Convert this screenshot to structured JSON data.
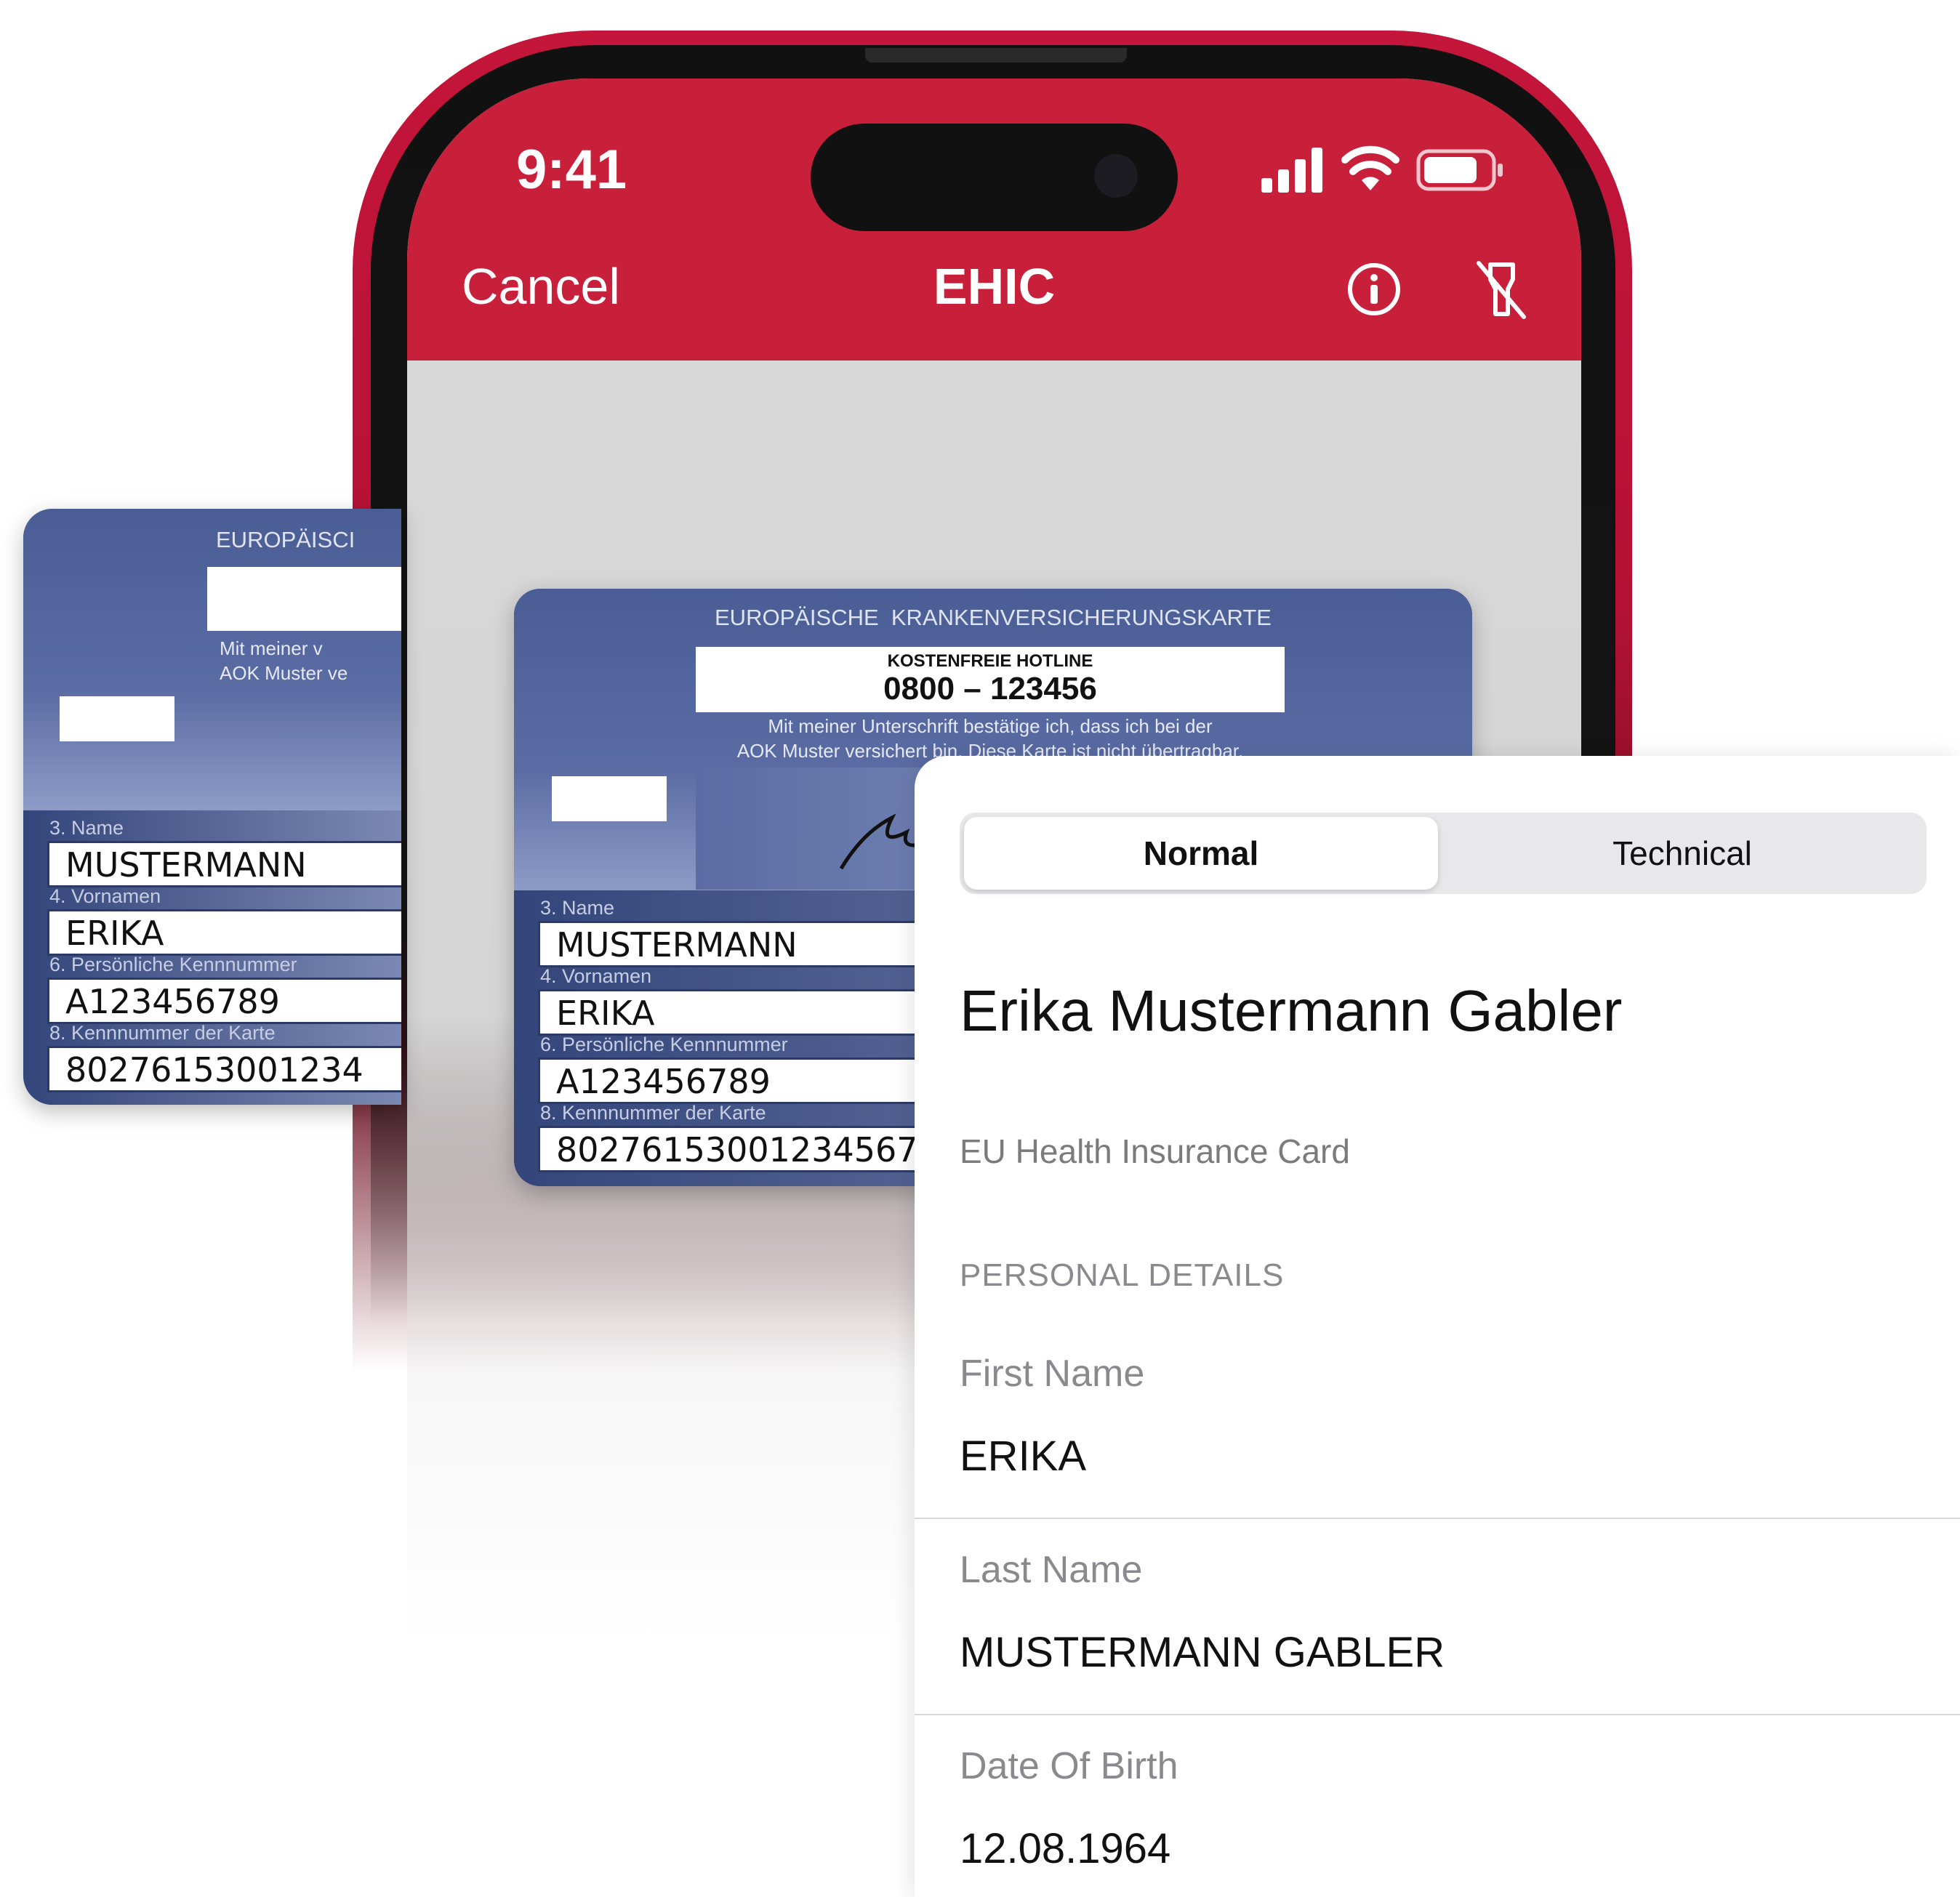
{
  "status_bar": {
    "time": "9:41"
  },
  "nav_bar": {
    "cancel_label": "Cancel",
    "title": "EHIC",
    "info_icon": "info-icon",
    "flashlight_icon": "flashlight-off-icon",
    "accent_color": "#c8203b"
  },
  "card": {
    "header": "EUROPÄISCHE  KRANKENVERSICHERUNGSKARTE",
    "header_partial": "EUROPÄISCI",
    "hotline_label": "KOSTENFREIE HOTLINE",
    "hotline_number": "0800 – 123456",
    "signature_text_1": "Mit meiner Unterschrift bestätige ich, dass ich bei der",
    "signature_text_2": "AOK Muster versichert bin. Diese Karte ist nicht übertragbar.",
    "signature_partial_1": "Mit meiner v",
    "signature_partial_2": "AOK Muster ve",
    "label_name": "3. Name",
    "value_name": "MUSTERMANN",
    "label_first": "4. Vornamen",
    "value_first": "ERIKA",
    "label_personal_id": "6. Persönliche Kennnummer",
    "value_personal_id": "A123456789",
    "label_card_id": "8. Kennnummer der Karte",
    "value_card_id": "80276153001234567",
    "value_card_id_partial": "80276153001234"
  },
  "result": {
    "segments": {
      "normal": "Normal",
      "technical": "Technical",
      "selected": "Normal"
    },
    "holder_name": "Erika Mustermann Gabler",
    "document_type": "EU Health Insurance Card",
    "section_title": "PERSONAL DETAILS",
    "fields": [
      {
        "label": "First Name",
        "value": "ERIKA"
      },
      {
        "label": "Last Name",
        "value": "MUSTERMANN GABLER"
      },
      {
        "label": "Date Of Birth",
        "value": "12.08.1964"
      }
    ]
  }
}
